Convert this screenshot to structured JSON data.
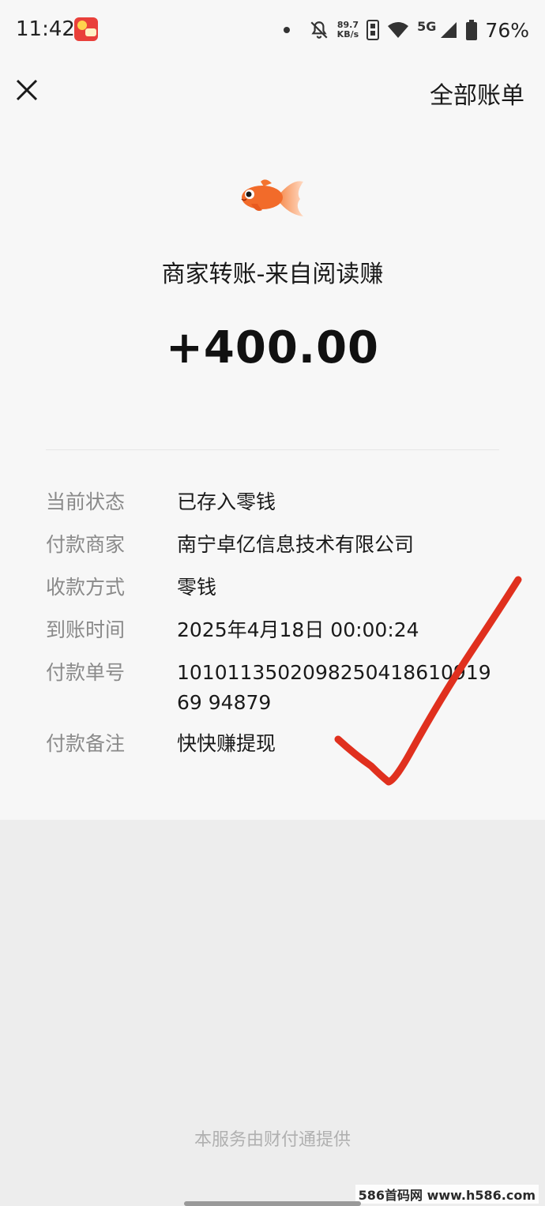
{
  "status_bar": {
    "time": "11:42",
    "speed_value": "89.7",
    "speed_unit": "KB/s",
    "network": "5G",
    "battery": "76%"
  },
  "nav": {
    "all_bills": "全部账单"
  },
  "transaction": {
    "title": "商家转账-来自阅读赚",
    "amount": "+400.00"
  },
  "details": [
    {
      "label": "当前状态",
      "value": "已存入零钱"
    },
    {
      "label": "付款商家",
      "value": "南宁卓亿信息技术有限公司"
    },
    {
      "label": "收款方式",
      "value": "零钱"
    },
    {
      "label": "到账时间",
      "value": "2025年4月18日 00:00:24"
    },
    {
      "label": "付款单号",
      "value": "101011350209825041861091969 94879"
    },
    {
      "label": "付款备注",
      "value": "快快赚提现"
    }
  ],
  "footer": {
    "provider_note": "本服务由财付通提供"
  },
  "watermark": "586首码网 www.h586.com",
  "colors": {
    "checkmark": "#e0301e",
    "fish": "#f26b2a"
  }
}
